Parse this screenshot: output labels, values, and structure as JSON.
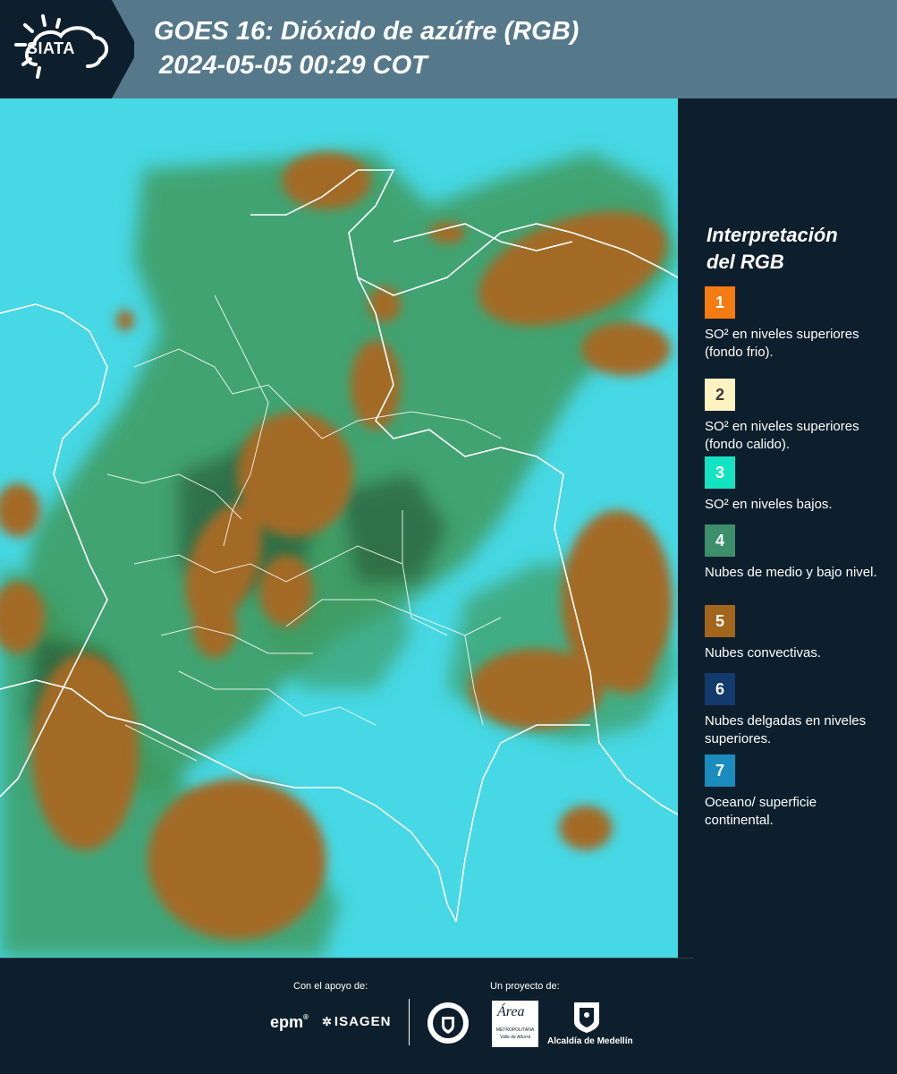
{
  "header": {
    "logo_text": "SIATA",
    "title_line1": "GOES 16: Dióxido de azúfre (RGB)",
    "title_line2": "2024-05-05 00:29 COT"
  },
  "legend": {
    "title_line1": "Interpretación",
    "title_line2": "del RGB",
    "items": [
      {
        "number": "1",
        "label": "SO² en niveles superiores (fondo frio).",
        "color": "#f47c13"
      },
      {
        "number": "2",
        "label": "SO² en niveles superiores (fondo calido).",
        "color": "#fff3c2"
      },
      {
        "number": "3",
        "label": "SO² en niveles bajos.",
        "color": "#14e3c2"
      },
      {
        "number": "4",
        "label": "Nubes de medio y bajo nivel.",
        "color": "#3c8f6a"
      },
      {
        "number": "5",
        "label": "Nubes convectivas.",
        "color": "#a2651c"
      },
      {
        "number": "6",
        "label": "Nubes delgadas en niveles superiores.",
        "color": "#123a6c"
      },
      {
        "number": "7",
        "label": "Oceano/ superficie continental.",
        "color": "#1a8cbd"
      }
    ]
  },
  "footer": {
    "support_label": "Con el apoyo de:",
    "project_label": "Un proyecto de:",
    "brand_epm": "epm",
    "brand_isagen": "ISAGEN",
    "brand_area_line1": "Área",
    "brand_area_line2": "METROPOLITANA",
    "brand_area_line3": "Valle de Aburrá",
    "brand_alcaldia": "Alcaldía de Medellín"
  },
  "map": {
    "colors": {
      "background": "#46d8e4",
      "cloud_green": "#3f9a5e",
      "convective": "#a36a28",
      "boundaries": "#ffffff"
    }
  }
}
